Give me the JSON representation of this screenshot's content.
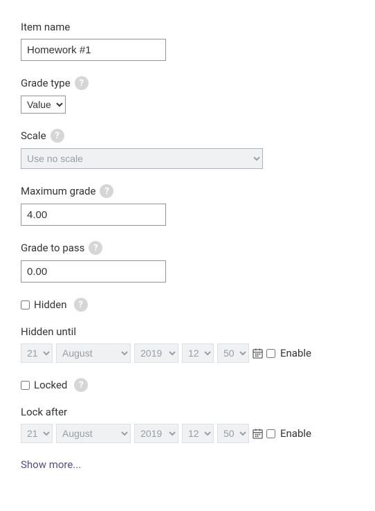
{
  "item_name": {
    "label": "Item name",
    "value": "Homework #1"
  },
  "grade_type": {
    "label": "Grade type",
    "value": "Value"
  },
  "scale": {
    "label": "Scale",
    "value": "Use no scale"
  },
  "max_grade": {
    "label": "Maximum grade",
    "value": "4.00"
  },
  "grade_to_pass": {
    "label": "Grade to pass",
    "value": "0.00"
  },
  "hidden": {
    "label": "Hidden"
  },
  "hidden_until": {
    "label": "Hidden until",
    "day": "21",
    "month": "August",
    "year": "2019",
    "hour": "12",
    "minute": "50",
    "enable": "Enable"
  },
  "locked": {
    "label": "Locked"
  },
  "lock_after": {
    "label": "Lock after",
    "day": "21",
    "month": "August",
    "year": "2019",
    "hour": "12",
    "minute": "50",
    "enable": "Enable"
  },
  "show_more": "Show more...",
  "help_glyph": "?"
}
